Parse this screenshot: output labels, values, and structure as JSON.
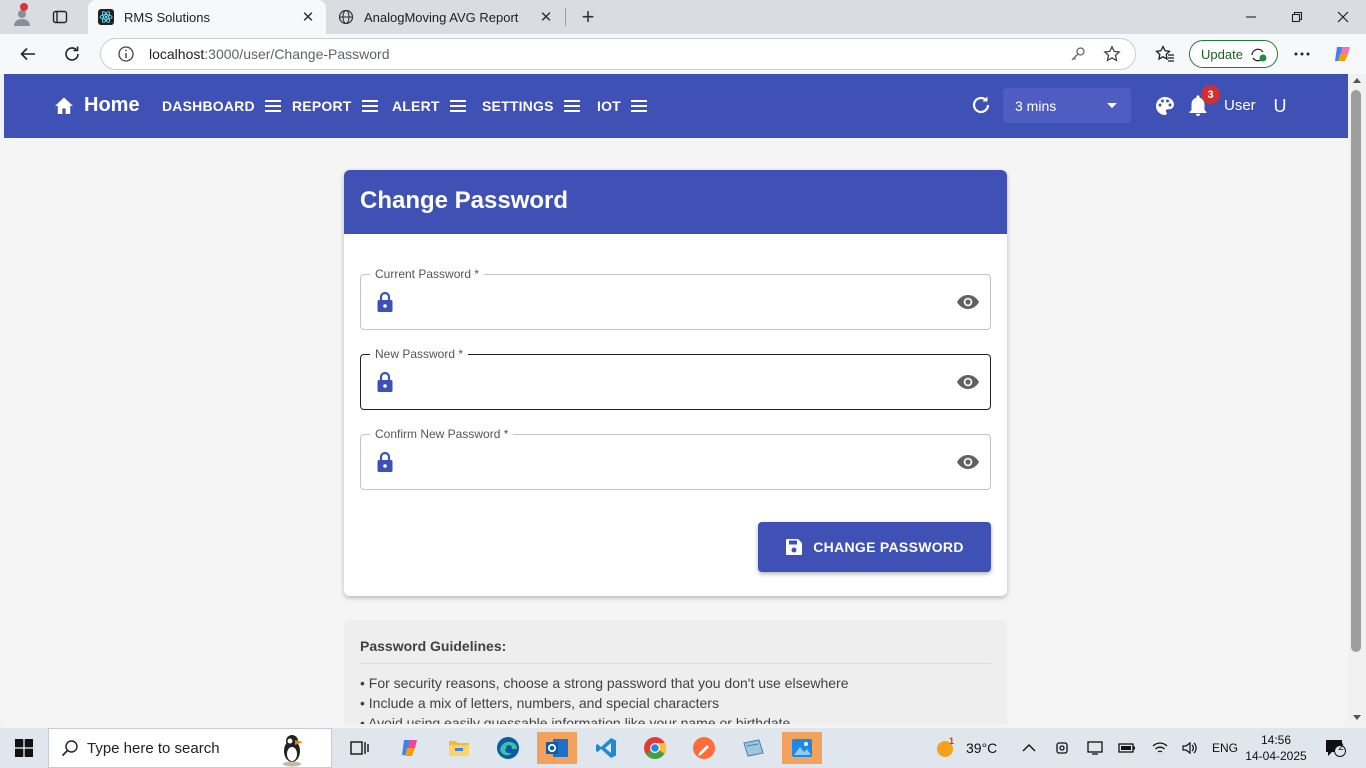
{
  "browser": {
    "tabs": [
      {
        "title": "RMS Solutions",
        "active": true
      },
      {
        "title": "AnalogMoving AVG Report",
        "active": false
      }
    ],
    "address": {
      "host": "localhost",
      "path": ":3000/user/Change-Password"
    },
    "update_label": "Update"
  },
  "appbar": {
    "home_label": "Home",
    "nav": [
      {
        "label": "DASHBOARD"
      },
      {
        "label": "REPORT"
      },
      {
        "label": "ALERT"
      },
      {
        "label": "SETTINGS"
      },
      {
        "label": "IOT"
      }
    ],
    "refresh_interval": "3 mins",
    "notification_count": "3",
    "user_label": "User",
    "avatar_initial": "U"
  },
  "card": {
    "title": "Change Password",
    "fields": [
      {
        "label": "Current Password *",
        "value": ""
      },
      {
        "label": "New Password *",
        "value": ""
      },
      {
        "label": "Confirm New Password *",
        "value": ""
      }
    ],
    "submit_label": "CHANGE PASSWORD"
  },
  "guidelines": {
    "title": "Password Guidelines:",
    "items": [
      "• For security reasons, choose a strong password that you don't use elsewhere",
      "• Include a mix of letters, numbers, and special characters",
      "• Avoid using easily guessable information like your name or birthdate"
    ]
  },
  "taskbar": {
    "search_placeholder": "Type here to search",
    "weather_temp": "39°C",
    "weather_badge": "1",
    "language": "ENG",
    "time": "14:56",
    "date": "14-04-2025",
    "notification_count": "2"
  },
  "colors": {
    "primary": "#3f51b5",
    "badge": "#d32f2f"
  }
}
